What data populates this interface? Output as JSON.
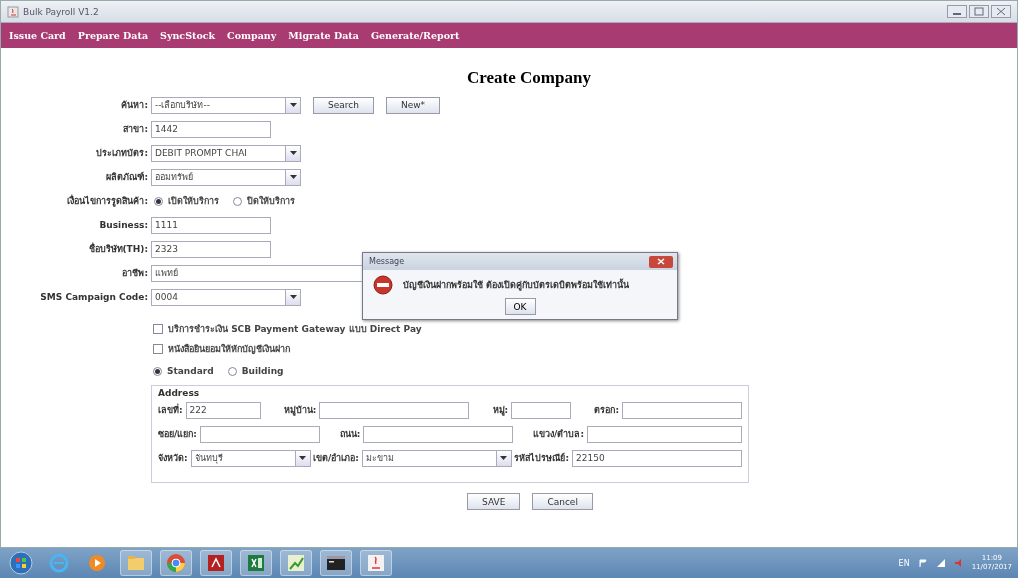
{
  "window": {
    "title": "Bulk Payroll V1.2"
  },
  "menu": [
    {
      "label": "Issue Card"
    },
    {
      "label": "Prepare Data"
    },
    {
      "label": "SyncStock"
    },
    {
      "label": "Company"
    },
    {
      "label": "Migrate Data"
    },
    {
      "label": "Generate/Report"
    }
  ],
  "form": {
    "title": "Create Company",
    "fields": [
      {
        "kind": "combo",
        "label": "ค้นหา:",
        "value": "--เลือกบริษัท--",
        "buttons": [
          "Search",
          "New*"
        ]
      },
      {
        "kind": "text",
        "label": "สาขา:",
        "value": "1442"
      },
      {
        "kind": "combo",
        "label": "ประเภทบัตร:",
        "value": "DEBIT PROMPT CHAI"
      },
      {
        "kind": "combo",
        "label": "ผลิตภัณฑ์:",
        "value": "ออมทรัพย์"
      },
      {
        "kind": "radio",
        "label": "เงื่อนไขการรูดสินค้า:",
        "options": [
          {
            "label": "เปิดให้บริการ",
            "selected": true
          },
          {
            "label": "ปิดให้บริการ",
            "selected": false
          }
        ]
      },
      {
        "kind": "text",
        "label": "Business:",
        "value": "1111"
      },
      {
        "kind": "text",
        "label": "ชื่อบริษัท(TH):",
        "value": "2323"
      },
      {
        "kind": "wide",
        "label": "อาชีพ:",
        "value": "แพทย์"
      },
      {
        "kind": "combo",
        "label": "SMS Campaign Code:",
        "value": "0004"
      }
    ],
    "checkboxes": [
      {
        "label": "บริการชำระเงิน SCB Payment Gateway แบบ Direct Pay",
        "checked": false
      },
      {
        "label": "หนังสือยินยอมให้หักบัญชีเงินฝาก",
        "checked": false
      }
    ],
    "address_type": [
      {
        "label": "Standard",
        "selected": true
      },
      {
        "label": "Building",
        "selected": false
      }
    ],
    "address": {
      "legend": "Address",
      "rows": [
        [
          {
            "kind": "text",
            "label": "เลขที่:",
            "value": "222"
          },
          {
            "kind": "text",
            "label": "หมู่บ้าน:"
          },
          {
            "kind": "text",
            "label": "หมู่:"
          },
          {
            "kind": "text",
            "label": "ตรอก:"
          }
        ],
        [
          {
            "kind": "text",
            "label": "ซอย/แยก:"
          },
          {
            "kind": "text",
            "label": "ถนน:"
          },
          {
            "kind": "text",
            "label": "แขวง/ตำบล:"
          }
        ],
        [
          {
            "kind": "combo",
            "label": "จังหวัด:",
            "value": "จันทบุรี"
          },
          {
            "kind": "combo",
            "label": "เขต/อำเภอ:",
            "value": "มะขาม"
          },
          {
            "kind": "text",
            "label": "รหัสไปรษณีย์:",
            "value": "22150"
          }
        ]
      ]
    },
    "buttons": [
      "SAVE",
      "Cancel"
    ]
  },
  "dialog": {
    "title": "Message",
    "message": "บัญชีเงินฝากพร้อมใช้ ต้องเปิดคู่กับบัตรเดบิตพร้อมใช้เท่านั้น",
    "button": "OK"
  },
  "taskbar": {
    "language": "EN",
    "time": "11:09",
    "date": "11/07/2017"
  }
}
